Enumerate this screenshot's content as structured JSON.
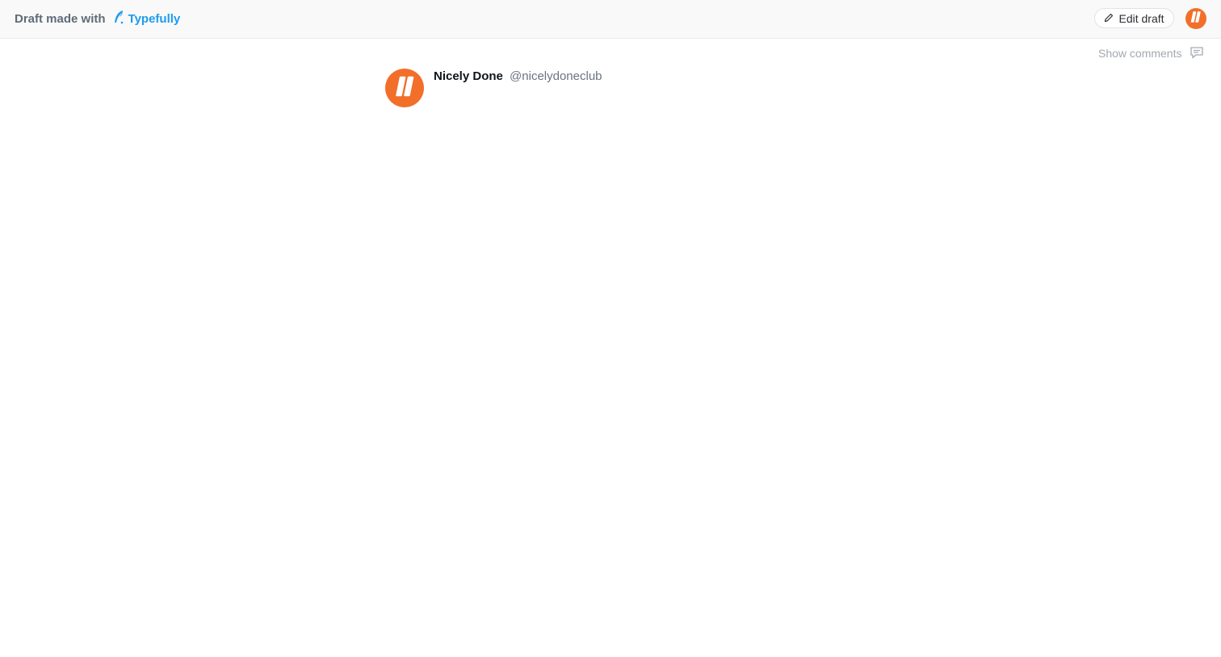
{
  "header": {
    "brand_prefix": "Draft made with",
    "brand_name": "Typefully",
    "brand_icon": "feather-icon",
    "edit_label": "Edit draft",
    "edit_icon": "pencil-icon",
    "account_avatar_icon": "nicely-done-logo-icon"
  },
  "toolbar": {
    "show_comments_label": "Show comments",
    "comments_icon": "comment-icon"
  },
  "post": {
    "author_name": "Nicely Done",
    "author_handle": "@nicelydoneclub",
    "avatar_icon": "nicely-done-logo-icon"
  },
  "colors": {
    "brand_blue": "#1d9bf0",
    "avatar_orange": "#f26f2a",
    "header_bg": "#f9f9f9"
  }
}
